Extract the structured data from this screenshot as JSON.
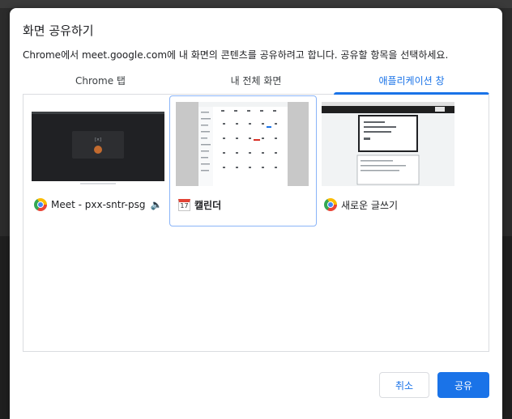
{
  "dialog": {
    "title": "화면 공유하기",
    "subtitle": "Chrome에서 meet.google.com에 내 화면의 콘텐츠를 공유하려고 합니다. 공유할 항목을 선택하세요."
  },
  "tabs": [
    {
      "label": "Chrome 탭",
      "active": false
    },
    {
      "label": "내 전체 화면",
      "active": false
    },
    {
      "label": "애플리케이션 창",
      "active": true
    }
  ],
  "windows": [
    {
      "label": "Meet - pxx-sntr-psg",
      "icon": "chrome-icon",
      "extra_icon": "speaker-icon",
      "selected": false
    },
    {
      "label": "캘린더",
      "icon": "calendar-icon",
      "selected": true,
      "icon_text": "17"
    },
    {
      "label": "새로운 글쓰기",
      "icon": "chrome-icon",
      "selected": false
    }
  ],
  "buttons": {
    "cancel": "취소",
    "share": "공유"
  },
  "colors": {
    "accent": "#1a73e8",
    "selected_border": "#8ab4f8"
  }
}
